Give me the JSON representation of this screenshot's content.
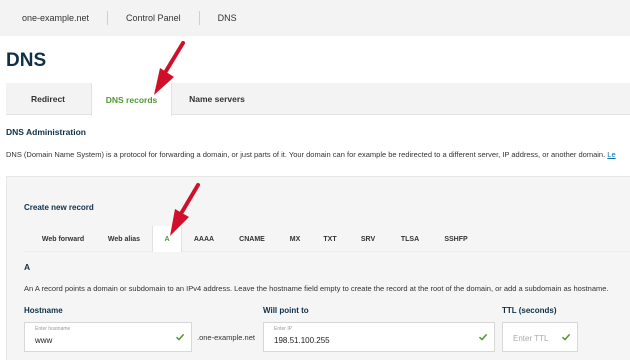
{
  "breadcrumb": [
    "one-example.net",
    "Control Panel",
    "DNS"
  ],
  "page_title": "DNS",
  "main_tabs": [
    {
      "label": "Redirect",
      "active": false
    },
    {
      "label": "DNS records",
      "active": true
    },
    {
      "label": "Name servers",
      "active": false
    }
  ],
  "section_heading": "DNS Administration",
  "intro_text": "DNS (Domain Name System) is a protocol for forwarding a domain, or just parts of it. Your domain can for example be redirected to a different server, IP address, or another domain.",
  "intro_link": "Le",
  "create": {
    "title": "Create new record",
    "tabs": [
      {
        "label": "Web forward",
        "active": false
      },
      {
        "label": "Web alias",
        "active": false
      },
      {
        "label": "A",
        "active": true
      },
      {
        "label": "AAAA",
        "active": false
      },
      {
        "label": "CNAME",
        "active": false
      },
      {
        "label": "MX",
        "active": false
      },
      {
        "label": "TXT",
        "active": false
      },
      {
        "label": "SRV",
        "active": false
      },
      {
        "label": "TLSA",
        "active": false
      },
      {
        "label": "SSHFP",
        "active": false
      }
    ],
    "record_type": "A",
    "record_description": "An A record points a domain or subdomain to an IPv4 address. Leave the hostname field empty to create the record at the root of the domain, or add a subdomain as hostname.",
    "hostname": {
      "label": "Hostname",
      "placeholder": "Enter hostname",
      "value": "www"
    },
    "domain_suffix": ".one-example.net",
    "ip": {
      "label": "Will point to",
      "placeholder": "Enter IP",
      "value": "198.51.100.255"
    },
    "ttl": {
      "label": "TTL (seconds)",
      "placeholder": "Enter TTL",
      "value": ""
    }
  },
  "colors": {
    "accent_green": "#4e9a2e",
    "heading_navy": "#0f3048",
    "arrow_red": "#d0102a"
  },
  "icons": [
    "check-icon",
    "arrow-pointer-icon"
  ]
}
